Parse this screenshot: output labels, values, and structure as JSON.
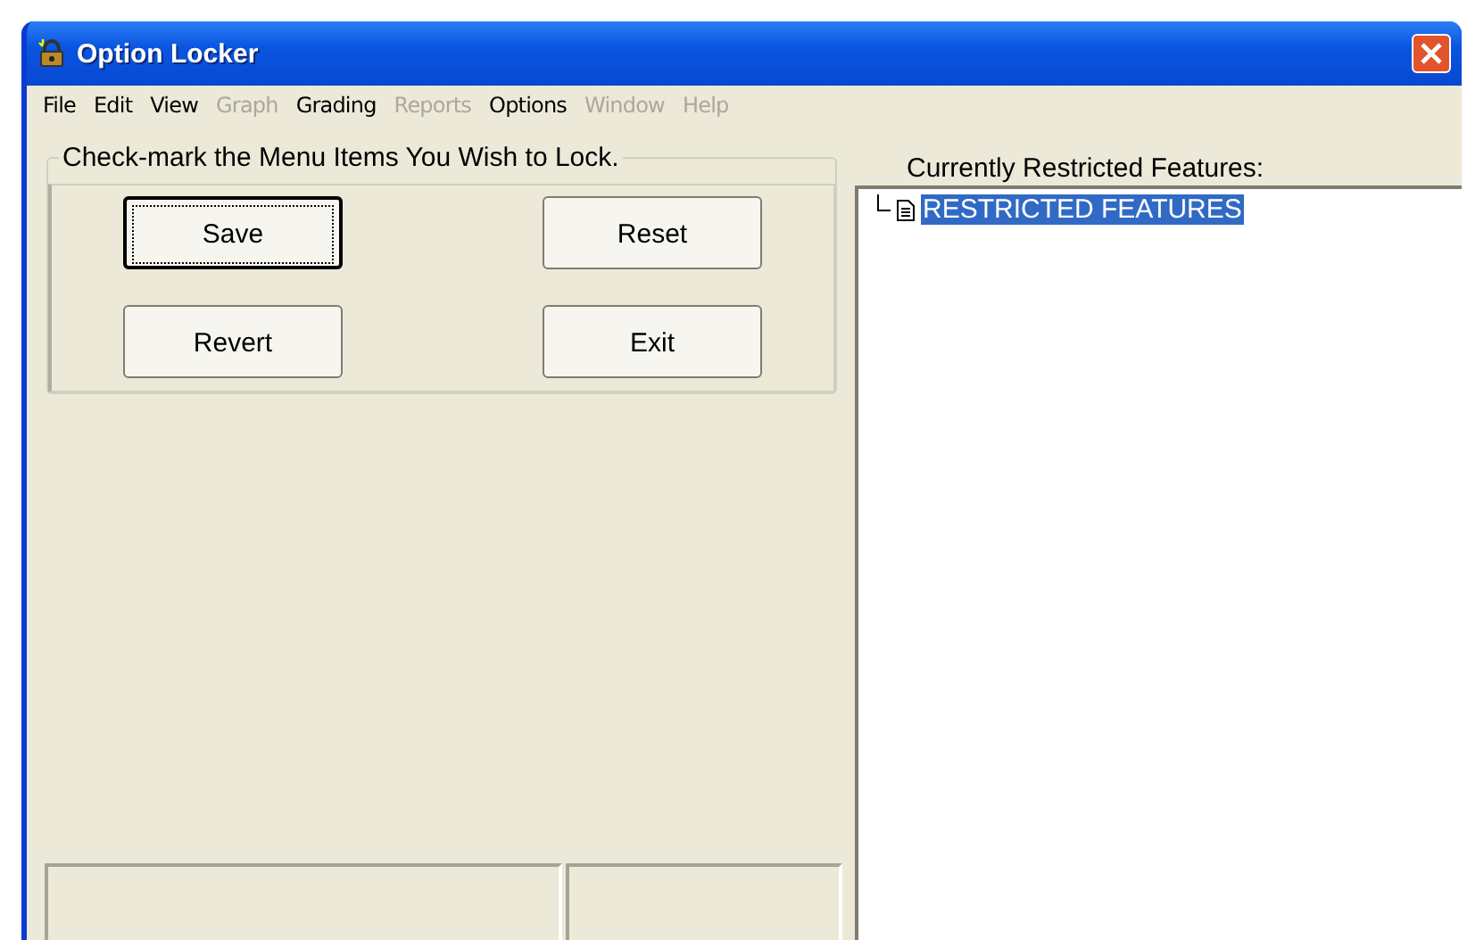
{
  "window": {
    "title": "Option Locker"
  },
  "menu": [
    {
      "label": "File",
      "disabled": false
    },
    {
      "label": "Edit",
      "disabled": false
    },
    {
      "label": "View",
      "disabled": false
    },
    {
      "label": "Graph",
      "disabled": true
    },
    {
      "label": "Grading",
      "disabled": false
    },
    {
      "label": "Reports",
      "disabled": true
    },
    {
      "label": "Options",
      "disabled": false
    },
    {
      "label": "Window",
      "disabled": true
    },
    {
      "label": "Help",
      "disabled": true
    }
  ],
  "group": {
    "title": "Check-mark the Menu Items You Wish to Lock.",
    "buttons": [
      {
        "label": "Save",
        "focused": true
      },
      {
        "label": "Reset",
        "focused": false
      },
      {
        "label": "Revert",
        "focused": false
      },
      {
        "label": "Exit",
        "focused": false
      }
    ]
  },
  "tree": {
    "label": "Currently Restricted Features:",
    "items": [
      {
        "label": "RESTRICTED FEATURES",
        "selected": true
      }
    ]
  }
}
